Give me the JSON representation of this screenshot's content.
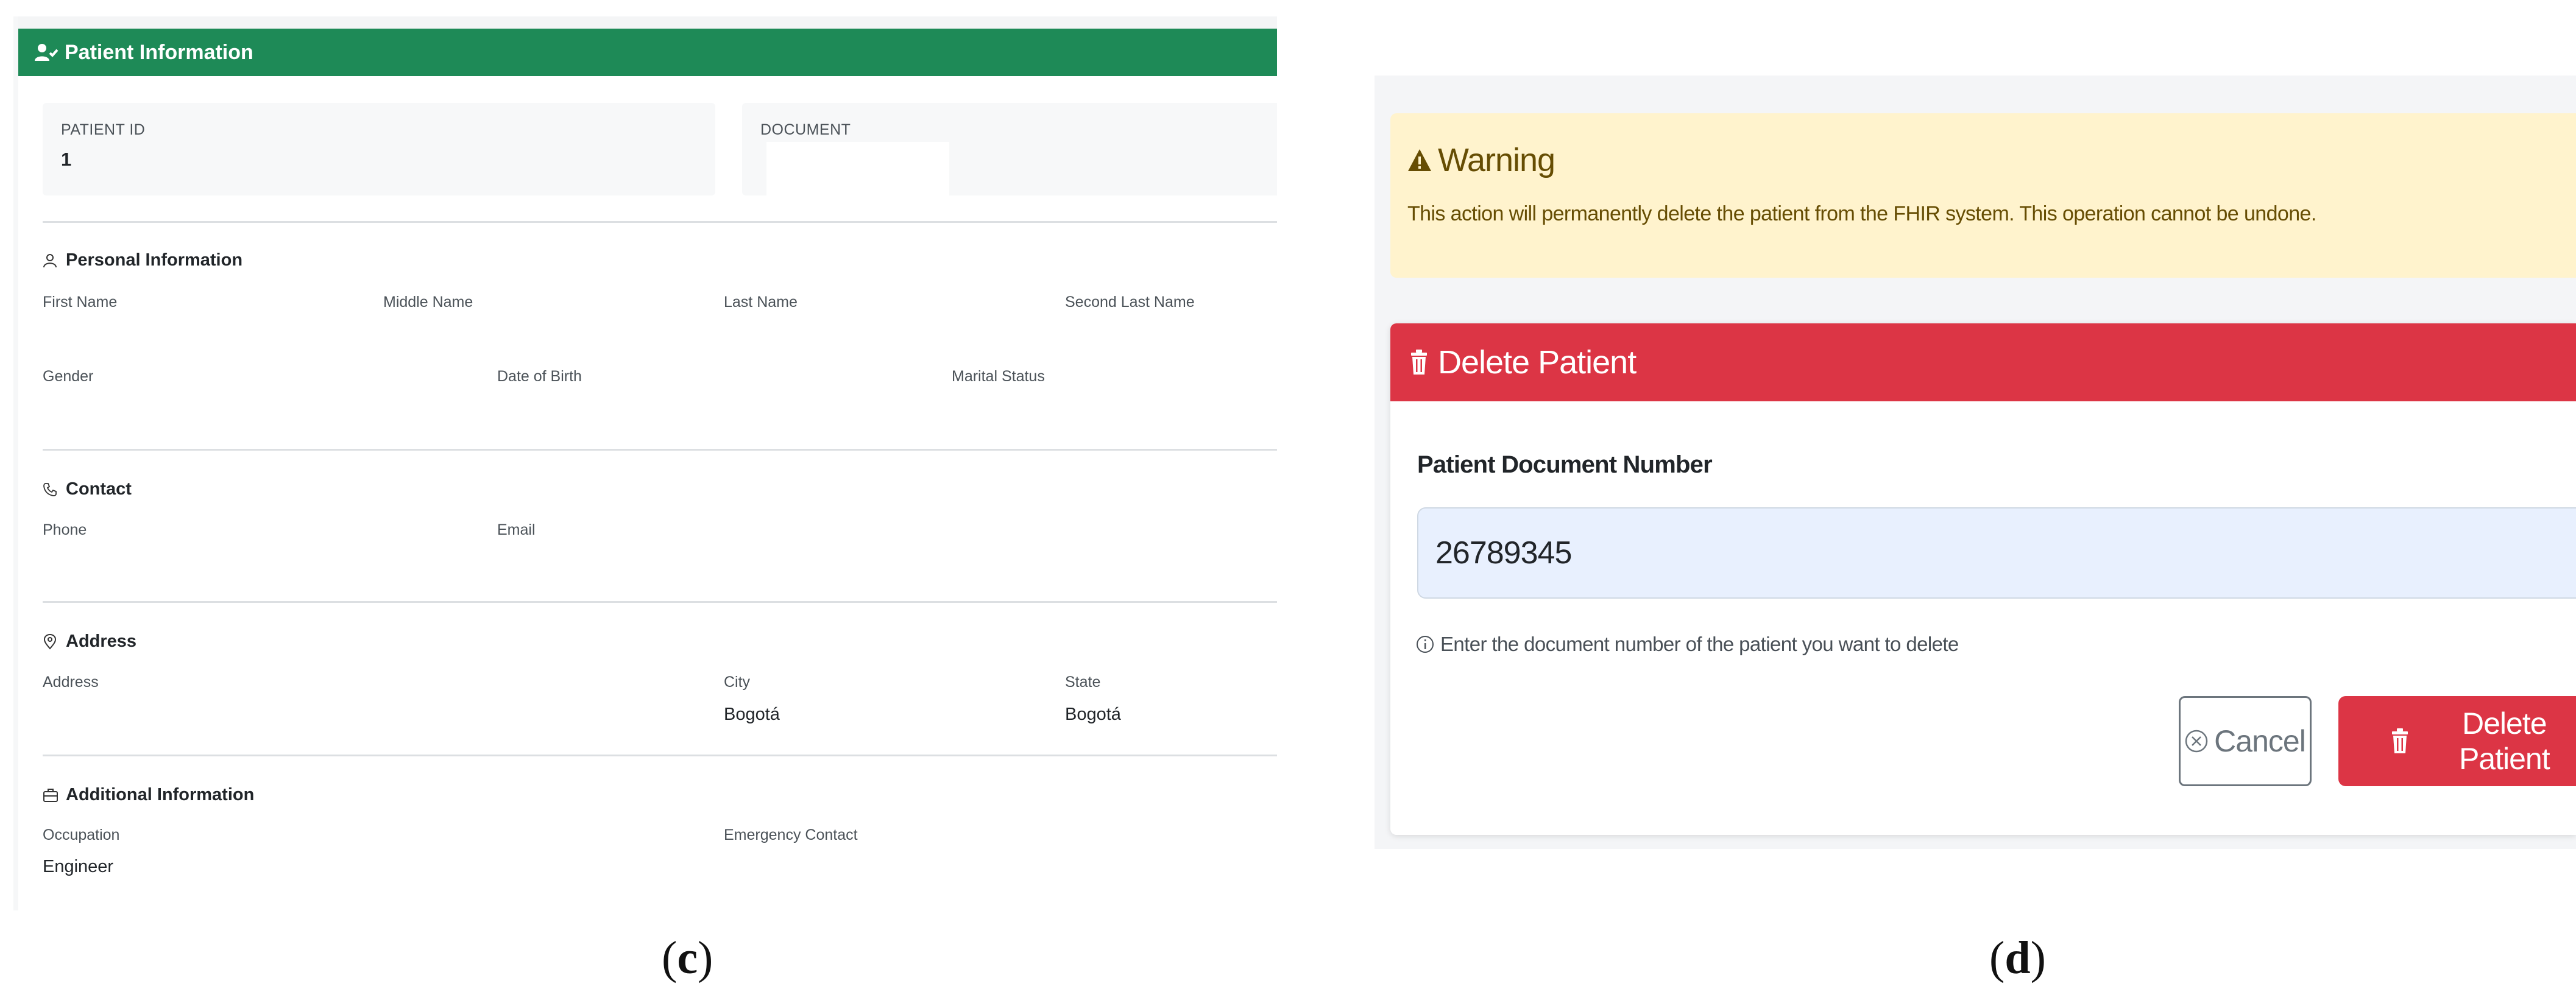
{
  "panel_c": {
    "header": "Patient Information",
    "patient_id_label": "PATIENT ID",
    "patient_id_value": "1",
    "document_label": "DOCUMENT",
    "document_value": "",
    "personal": {
      "title": "Personal Information",
      "first_name_label": "First Name",
      "middle_name_label": "Middle Name",
      "last_name_label": "Last Name",
      "second_last_name_label": "Second Last Name",
      "gender_label": "Gender",
      "dob_label": "Date of Birth",
      "marital_label": "Marital Status"
    },
    "contact": {
      "title": "Contact",
      "phone_label": "Phone",
      "email_label": "Email"
    },
    "address": {
      "title": "Address",
      "address_label": "Address",
      "city_label": "City",
      "city_value": "Bogotá",
      "state_label": "State",
      "state_value": "Bogotá"
    },
    "additional": {
      "title": "Additional Information",
      "occupation_label": "Occupation",
      "occupation_value": "Engineer",
      "emergency_label": "Emergency Contact"
    },
    "caption": "(c)",
    "caption_letter": "c"
  },
  "panel_d": {
    "warning_title": "Warning",
    "warning_text": "This action will permanently delete the patient from the FHIR system. This operation cannot be undone.",
    "card_title": "Delete Patient",
    "doc_label": "Patient Document Number",
    "doc_value": "26789345",
    "help_text": "Enter the document number of the patient you want to delete",
    "cancel_label": "Cancel",
    "delete_label": "Delete Patient",
    "caption_letter": "d"
  },
  "colors": {
    "success_green": "#1e8a57",
    "danger_red": "#dc3545",
    "warning_bg": "#fff3cd",
    "warning_text": "#664d03",
    "input_bg": "#e8f0fe"
  },
  "icons": {
    "header_icon": "user-check-icon",
    "personal_icon": "user-icon",
    "contact_icon": "phone-icon",
    "address_icon": "map-pin-icon",
    "additional_icon": "briefcase-icon",
    "warning_icon": "warning-triangle-icon",
    "delete_icon": "trash-icon",
    "help_icon": "info-icon",
    "cancel_icon": "x-circle-icon"
  }
}
